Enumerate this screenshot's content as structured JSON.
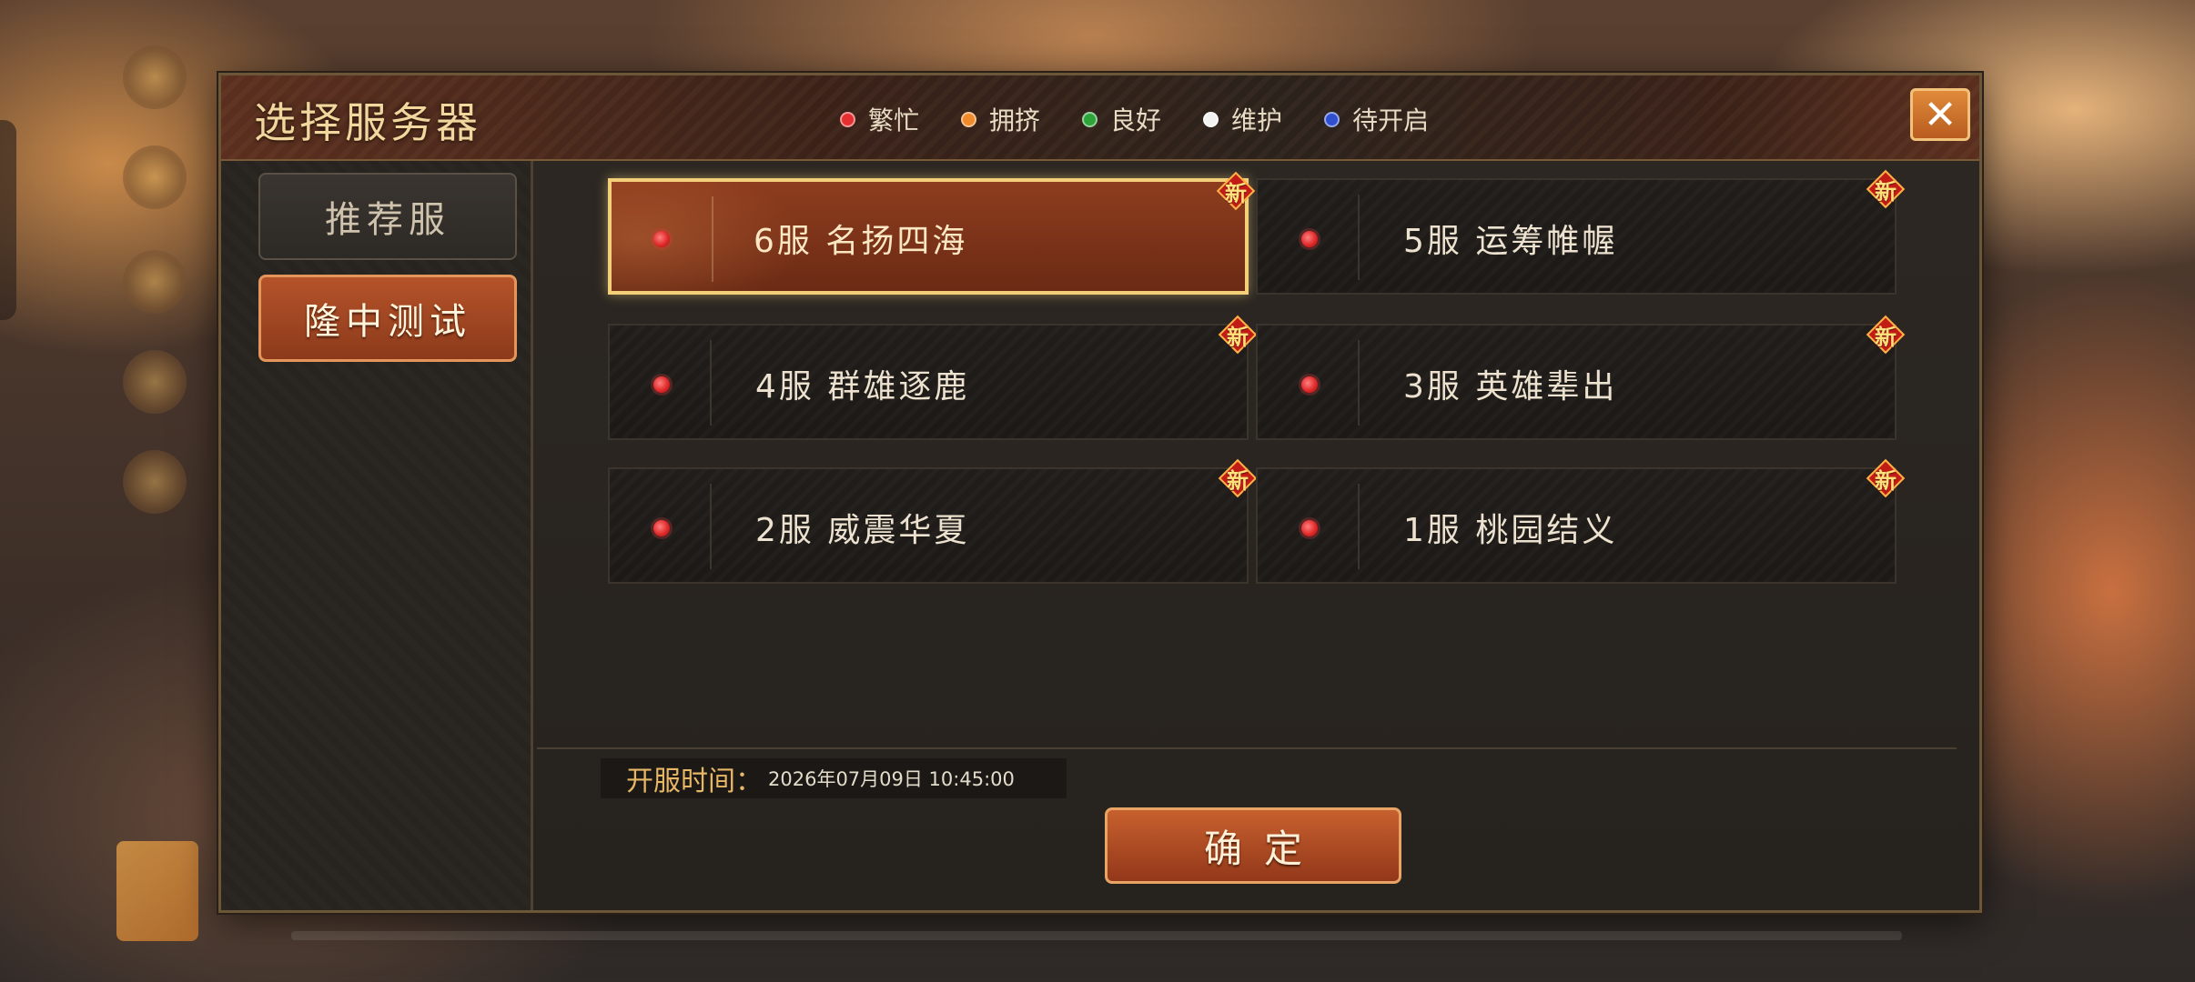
{
  "dialog": {
    "title": "选择服务器",
    "close_label": "✕"
  },
  "legend": [
    {
      "label": "繁忙",
      "color": "#e53030"
    },
    {
      "label": "拥挤",
      "color": "#f08a2a"
    },
    {
      "label": "良好",
      "color": "#2ea33a"
    },
    {
      "label": "维护",
      "color": "#f2f2f2"
    },
    {
      "label": "待开启",
      "color": "#3050d0"
    }
  ],
  "sidebar": {
    "items": [
      {
        "label": "推荐服",
        "active": false
      },
      {
        "label": "隆中测试",
        "active": true
      }
    ]
  },
  "servers": [
    {
      "name": "6服  名扬四海",
      "status": "繁忙",
      "badge": "新",
      "selected": true
    },
    {
      "name": "5服  运筹帷幄",
      "status": "繁忙",
      "badge": "新",
      "selected": false
    },
    {
      "name": "4服  群雄逐鹿",
      "status": "繁忙",
      "badge": "新",
      "selected": false
    },
    {
      "name": "3服  英雄辈出",
      "status": "繁忙",
      "badge": "新",
      "selected": false
    },
    {
      "name": "2服  威震华夏",
      "status": "繁忙",
      "badge": "新",
      "selected": false
    },
    {
      "name": "1服  桃园结义",
      "status": "繁忙",
      "badge": "新",
      "selected": false
    }
  ],
  "footer": {
    "open_time_label": "开服时间：",
    "open_time_value": "2026年07月09日  10:45:00",
    "confirm_label": "确定"
  }
}
